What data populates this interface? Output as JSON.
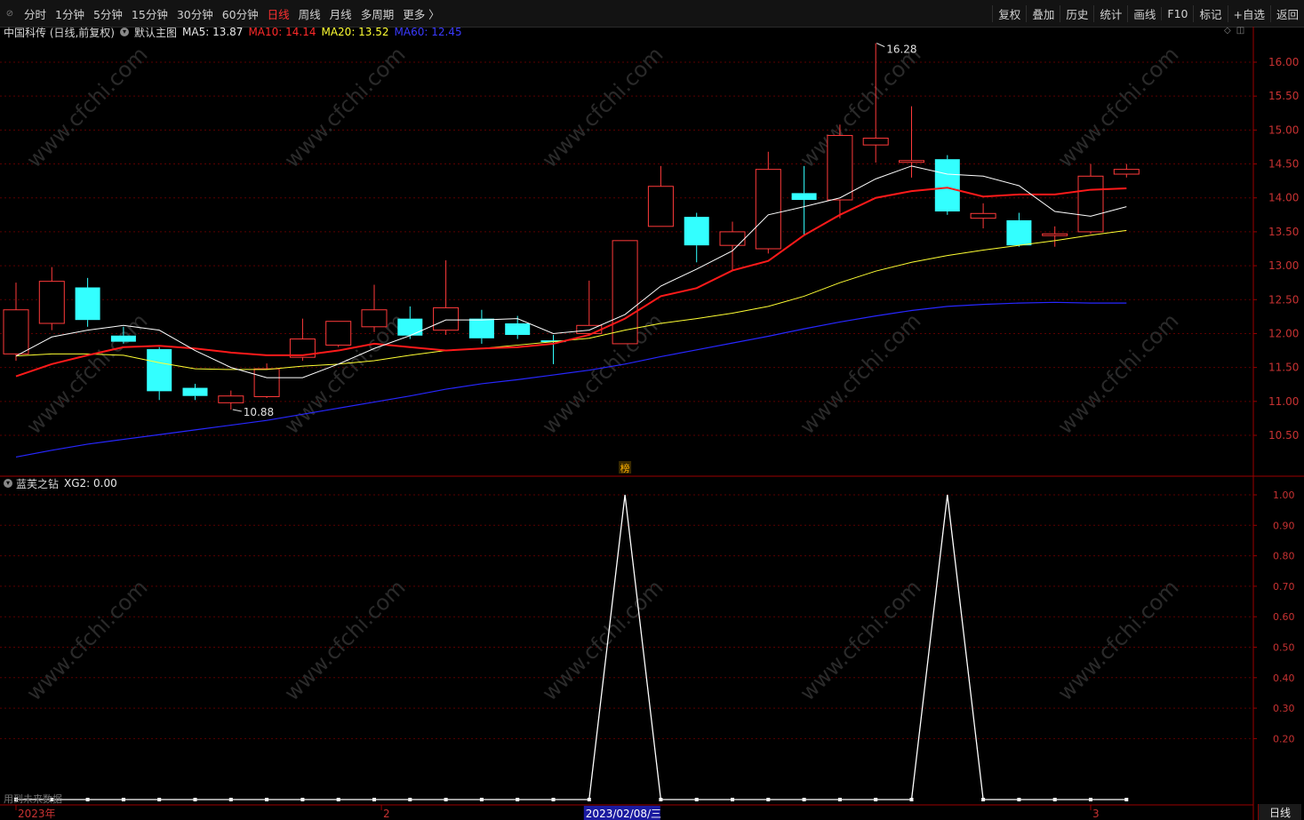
{
  "toolbar": {
    "corner_icon": "back-arrow-icon",
    "periods": [
      "分时",
      "1分钟",
      "5分钟",
      "15分钟",
      "30分钟",
      "60分钟",
      "日线",
      "周线",
      "月线",
      "多周期",
      "更多 〉"
    ],
    "active_period": "日线",
    "right_buttons": [
      "复权",
      "叠加",
      "历史",
      "统计",
      "画线",
      "F10",
      "标记",
      "+自选",
      "返回"
    ]
  },
  "header": {
    "stock_title": "中国科传 (日线,前复权)",
    "main_chart_label": "默认主图",
    "ma5": "MA5: 13.87",
    "ma10": "MA10: 14.14",
    "ma20": "MA20: 13.52",
    "ma60": "MA60: 12.45"
  },
  "colors": {
    "up": "#ff3a3a",
    "down": "#33ffff",
    "ma5": "#ffffff",
    "ma10": "#ff1a1a",
    "ma20": "#ffff33",
    "ma60": "#2727ff",
    "axis": "#9b0000",
    "grid": "#5a0000"
  },
  "indicator": {
    "name": "蓝芙之钻",
    "value_label": "XG2: 0.00"
  },
  "footer": {
    "future_data_label": "用到未来数据",
    "period_badge": "日线"
  },
  "chart_data": {
    "type": "candlestick",
    "price_axis": {
      "min": 10.1,
      "max": 16.4,
      "ticks": [
        "16.00",
        "15.50",
        "15.00",
        "14.50",
        "14.00",
        "13.50",
        "13.00",
        "12.50",
        "12.00",
        "11.50",
        "11.00",
        "10.50"
      ]
    },
    "candles": [
      {
        "o": 11.7,
        "c": 12.35,
        "h": 12.75,
        "l": 11.6
      },
      {
        "o": 12.15,
        "c": 12.77,
        "h": 12.98,
        "l": 12.05
      },
      {
        "o": 12.68,
        "c": 12.2,
        "h": 12.82,
        "l": 12.1
      },
      {
        "o": 11.97,
        "c": 11.88,
        "h": 12.1,
        "l": 11.85
      },
      {
        "o": 11.77,
        "c": 11.15,
        "h": 11.8,
        "l": 11.02
      },
      {
        "o": 11.2,
        "c": 11.08,
        "h": 11.26,
        "l": 11.02
      },
      {
        "o": 10.98,
        "c": 11.08,
        "h": 11.16,
        "l": 10.88
      },
      {
        "o": 11.07,
        "c": 11.48,
        "h": 11.56,
        "l": 11.05
      },
      {
        "o": 11.65,
        "c": 11.92,
        "h": 12.22,
        "l": 11.6
      },
      {
        "o": 11.83,
        "c": 12.18,
        "h": 12.18,
        "l": 11.8
      },
      {
        "o": 12.1,
        "c": 12.35,
        "h": 12.72,
        "l": 12.02
      },
      {
        "o": 12.22,
        "c": 11.97,
        "h": 12.4,
        "l": 11.92
      },
      {
        "o": 12.05,
        "c": 12.38,
        "h": 13.08,
        "l": 11.98
      },
      {
        "o": 12.22,
        "c": 11.93,
        "h": 12.35,
        "l": 11.85
      },
      {
        "o": 12.15,
        "c": 11.98,
        "h": 12.26,
        "l": 11.92
      },
      {
        "o": 11.9,
        "c": 11.88,
        "h": 11.98,
        "l": 11.55
      },
      {
        "o": 12.0,
        "c": 12.12,
        "h": 12.78,
        "l": 11.98
      },
      {
        "o": 11.85,
        "c": 13.37,
        "h": 13.37,
        "l": 11.85
      },
      {
        "o": 13.58,
        "c": 14.17,
        "h": 14.47,
        "l": 13.58
      },
      {
        "o": 13.72,
        "c": 13.3,
        "h": 13.78,
        "l": 13.05
      },
      {
        "o": 13.3,
        "c": 13.5,
        "h": 13.65,
        "l": 12.93
      },
      {
        "o": 13.25,
        "c": 14.42,
        "h": 14.68,
        "l": 13.18
      },
      {
        "o": 14.07,
        "c": 13.97,
        "h": 14.47,
        "l": 13.45
      },
      {
        "o": 13.97,
        "c": 14.92,
        "h": 15.08,
        "l": 13.7
      },
      {
        "o": 14.78,
        "c": 14.88,
        "h": 16.28,
        "l": 14.52
      },
      {
        "o": 14.55,
        "c": 14.55,
        "h": 15.35,
        "l": 14.3
      },
      {
        "o": 14.57,
        "c": 13.8,
        "h": 14.63,
        "l": 13.75
      },
      {
        "o": 13.7,
        "c": 13.77,
        "h": 13.92,
        "l": 13.55
      },
      {
        "o": 13.67,
        "c": 13.3,
        "h": 13.78,
        "l": 13.28
      },
      {
        "o": 13.45,
        "c": 13.47,
        "h": 13.58,
        "l": 13.28
      },
      {
        "o": 13.5,
        "c": 14.32,
        "h": 14.5,
        "l": 13.47
      },
      {
        "o": 14.35,
        "c": 14.42,
        "h": 14.5,
        "l": 14.3
      }
    ],
    "ma5": [
      11.67,
      11.95,
      12.05,
      12.12,
      12.05,
      11.75,
      11.5,
      11.35,
      11.35,
      11.55,
      11.78,
      11.97,
      12.2,
      12.2,
      12.22,
      12.0,
      12.05,
      12.28,
      12.7,
      12.95,
      13.22,
      13.75,
      13.87,
      14.0,
      14.28,
      14.47,
      14.35,
      14.32,
      14.18,
      13.8,
      13.73,
      13.87
    ],
    "ma10": [
      11.37,
      11.55,
      11.68,
      11.8,
      11.82,
      11.78,
      11.72,
      11.68,
      11.68,
      11.75,
      11.85,
      11.8,
      11.75,
      11.78,
      11.8,
      11.85,
      11.98,
      12.22,
      12.55,
      12.67,
      12.93,
      13.07,
      13.45,
      13.75,
      14.0,
      14.1,
      14.15,
      14.02,
      14.05,
      14.05,
      14.12,
      14.14
    ],
    "ma20": [
      11.67,
      11.7,
      11.7,
      11.68,
      11.57,
      11.48,
      11.47,
      11.47,
      11.52,
      11.55,
      11.6,
      11.68,
      11.75,
      11.78,
      11.83,
      11.88,
      11.93,
      12.05,
      12.15,
      12.22,
      12.3,
      12.4,
      12.55,
      12.75,
      12.92,
      13.05,
      13.15,
      13.23,
      13.3,
      13.37,
      13.45,
      13.52
    ],
    "ma60": [
      10.18,
      10.28,
      10.37,
      10.44,
      10.51,
      10.58,
      10.65,
      10.72,
      10.81,
      10.9,
      10.99,
      11.08,
      11.18,
      11.26,
      11.32,
      11.39,
      11.46,
      11.55,
      11.66,
      11.76,
      11.86,
      11.96,
      12.07,
      12.17,
      12.26,
      12.34,
      12.4,
      12.43,
      12.45,
      12.46,
      12.45,
      12.45
    ],
    "annotations": [
      {
        "index": 24,
        "label": "16.28"
      },
      {
        "index": 6,
        "label": "10.88"
      }
    ],
    "indicator_axis": {
      "min": 0,
      "max": 1.05,
      "ticks": [
        "1.00",
        "0.90",
        "0.80",
        "0.70",
        "0.60",
        "0.50",
        "0.40",
        "0.30",
        "0.20"
      ]
    },
    "xg2": [
      0,
      0,
      0,
      0,
      0,
      0,
      0,
      0,
      0,
      0,
      0,
      0,
      0,
      0,
      0,
      0,
      0,
      1,
      0,
      0,
      0,
      0,
      0,
      0,
      0,
      0,
      1,
      0,
      0,
      0,
      0,
      0
    ],
    "x_labels": [
      {
        "index": 0,
        "text": "2023年"
      },
      {
        "index": 10.2,
        "text": "2"
      },
      {
        "index": 16,
        "text": "2023/02/08/三",
        "highlight": true
      },
      {
        "index": 30,
        "text": "3"
      }
    ],
    "marker_label": "榜"
  }
}
